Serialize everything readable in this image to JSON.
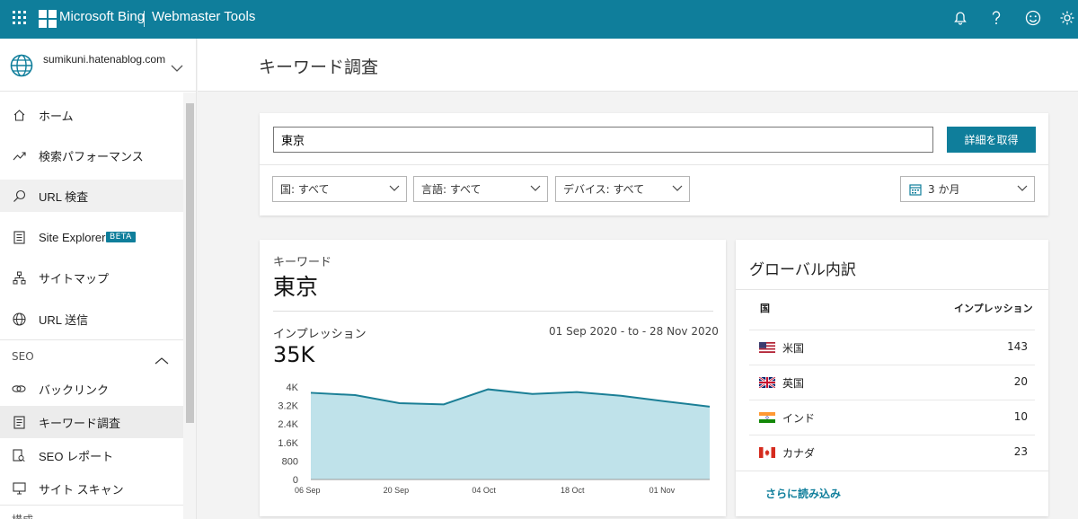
{
  "topbar": {
    "brand": "Microsoft Bing",
    "product": "Webmaster Tools"
  },
  "site": {
    "name": "sumikuni.hatenablog.com"
  },
  "nav": {
    "home": "ホーム",
    "search_performance": "検索パフォーマンス",
    "url_inspection": "URL 検査",
    "site_explorer": "Site Explorer",
    "beta_badge": "BETA",
    "sitemaps": "サイトマップ",
    "url_submission": "URL 送信",
    "seo_section": "SEO",
    "backlinks": "バックリンク",
    "keyword_research": "キーワード調査",
    "seo_reports": "SEO レポート",
    "site_scan": "サイト スキャン",
    "config_section": "構成"
  },
  "header": {
    "title": "キーワード調査"
  },
  "search": {
    "value": "東京",
    "button": "詳細を取得",
    "filters": {
      "country": "国: すべて",
      "language": "言語: すべて",
      "device": "デバイス: すべて",
      "period": "3 か月"
    }
  },
  "keyword_card": {
    "label": "キーワード",
    "keyword": "東京",
    "impressions_label": "インプレッション",
    "date_range": "01 Sep 2020 - to - 28 Nov 2020",
    "impressions_total": "35K"
  },
  "chart_data": {
    "type": "area",
    "x": [
      "06 Sep",
      "13 Sep",
      "20 Sep",
      "27 Sep",
      "04 Oct",
      "11 Oct",
      "18 Oct",
      "25 Oct",
      "01 Nov",
      "08 Nov"
    ],
    "xticks": [
      "06 Sep",
      "20 Sep",
      "04 Oct",
      "18 Oct",
      "01 Nov"
    ],
    "values": [
      3750,
      3650,
      3300,
      3250,
      3900,
      3700,
      3780,
      3620,
      3380,
      3150
    ],
    "yticks": [
      "0",
      "800",
      "1.6K",
      "2.4K",
      "3.2K",
      "4K"
    ],
    "ylim": [
      0,
      4000
    ],
    "color": "#1b7f96",
    "fill": "#bfe2ea",
    "grid": false
  },
  "global": {
    "title": "グローバル内訳",
    "col_country": "国",
    "col_impressions": "インプレッション",
    "rows": [
      {
        "country": "米国",
        "value": "143",
        "flag": "us-flag"
      },
      {
        "country": "英国",
        "value": "20",
        "flag": "uk-flag"
      },
      {
        "country": "インド",
        "value": "10",
        "flag": "india-flag"
      },
      {
        "country": "カナダ",
        "value": "23",
        "flag": "canada-flag"
      }
    ],
    "load_more": "さらに読み込み"
  },
  "colors": {
    "accent": "#0f7e9b"
  }
}
